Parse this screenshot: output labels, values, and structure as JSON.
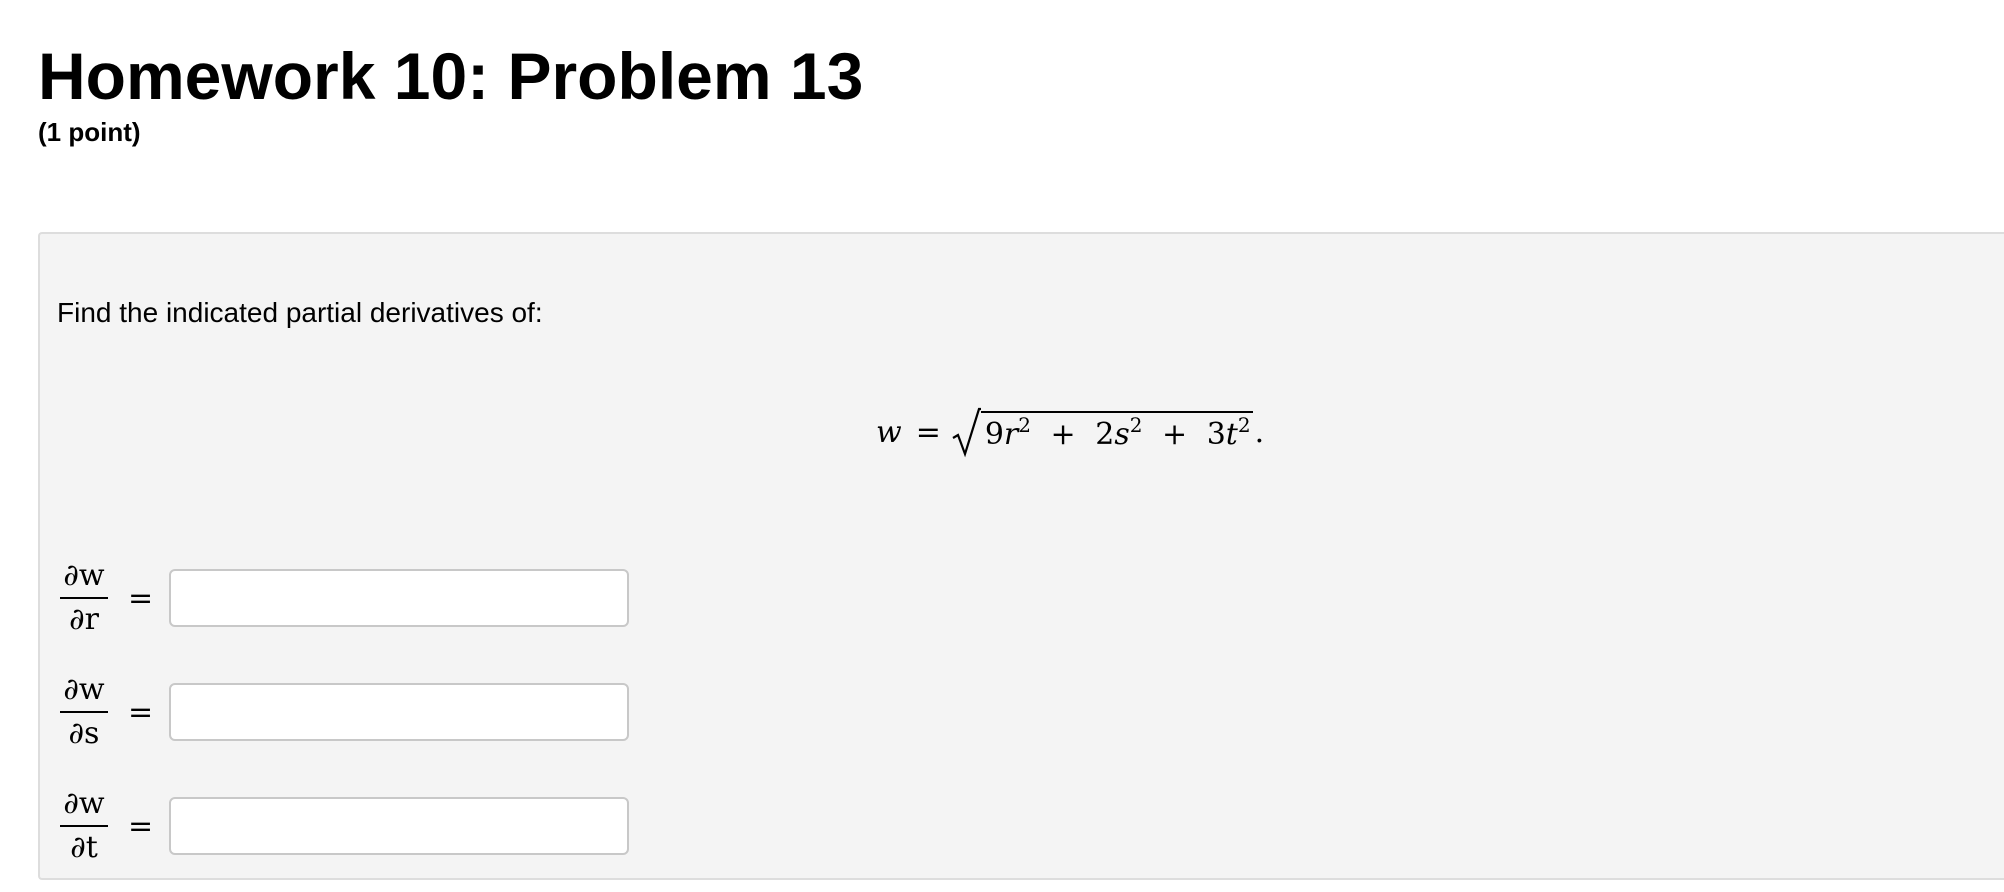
{
  "header": {
    "title": "Homework 10: Problem 13",
    "points": "(1 point)"
  },
  "problem": {
    "prompt": "Find the indicated partial derivatives of:",
    "equation": {
      "lhs": "w",
      "eq": "=",
      "radicand_terms": [
        {
          "coef": "9",
          "var": "r",
          "exp": "2"
        },
        {
          "op": "+",
          "coef": "2",
          "var": "s",
          "exp": "2"
        },
        {
          "op": "+",
          "coef": "3",
          "var": "t",
          "exp": "2"
        }
      ],
      "end": "."
    },
    "answers": [
      {
        "numerator": "∂w",
        "denominator": "∂r",
        "eq": "=",
        "value": ""
      },
      {
        "numerator": "∂w",
        "denominator": "∂s",
        "eq": "=",
        "value": ""
      },
      {
        "numerator": "∂w",
        "denominator": "∂t",
        "eq": "=",
        "value": ""
      }
    ]
  }
}
